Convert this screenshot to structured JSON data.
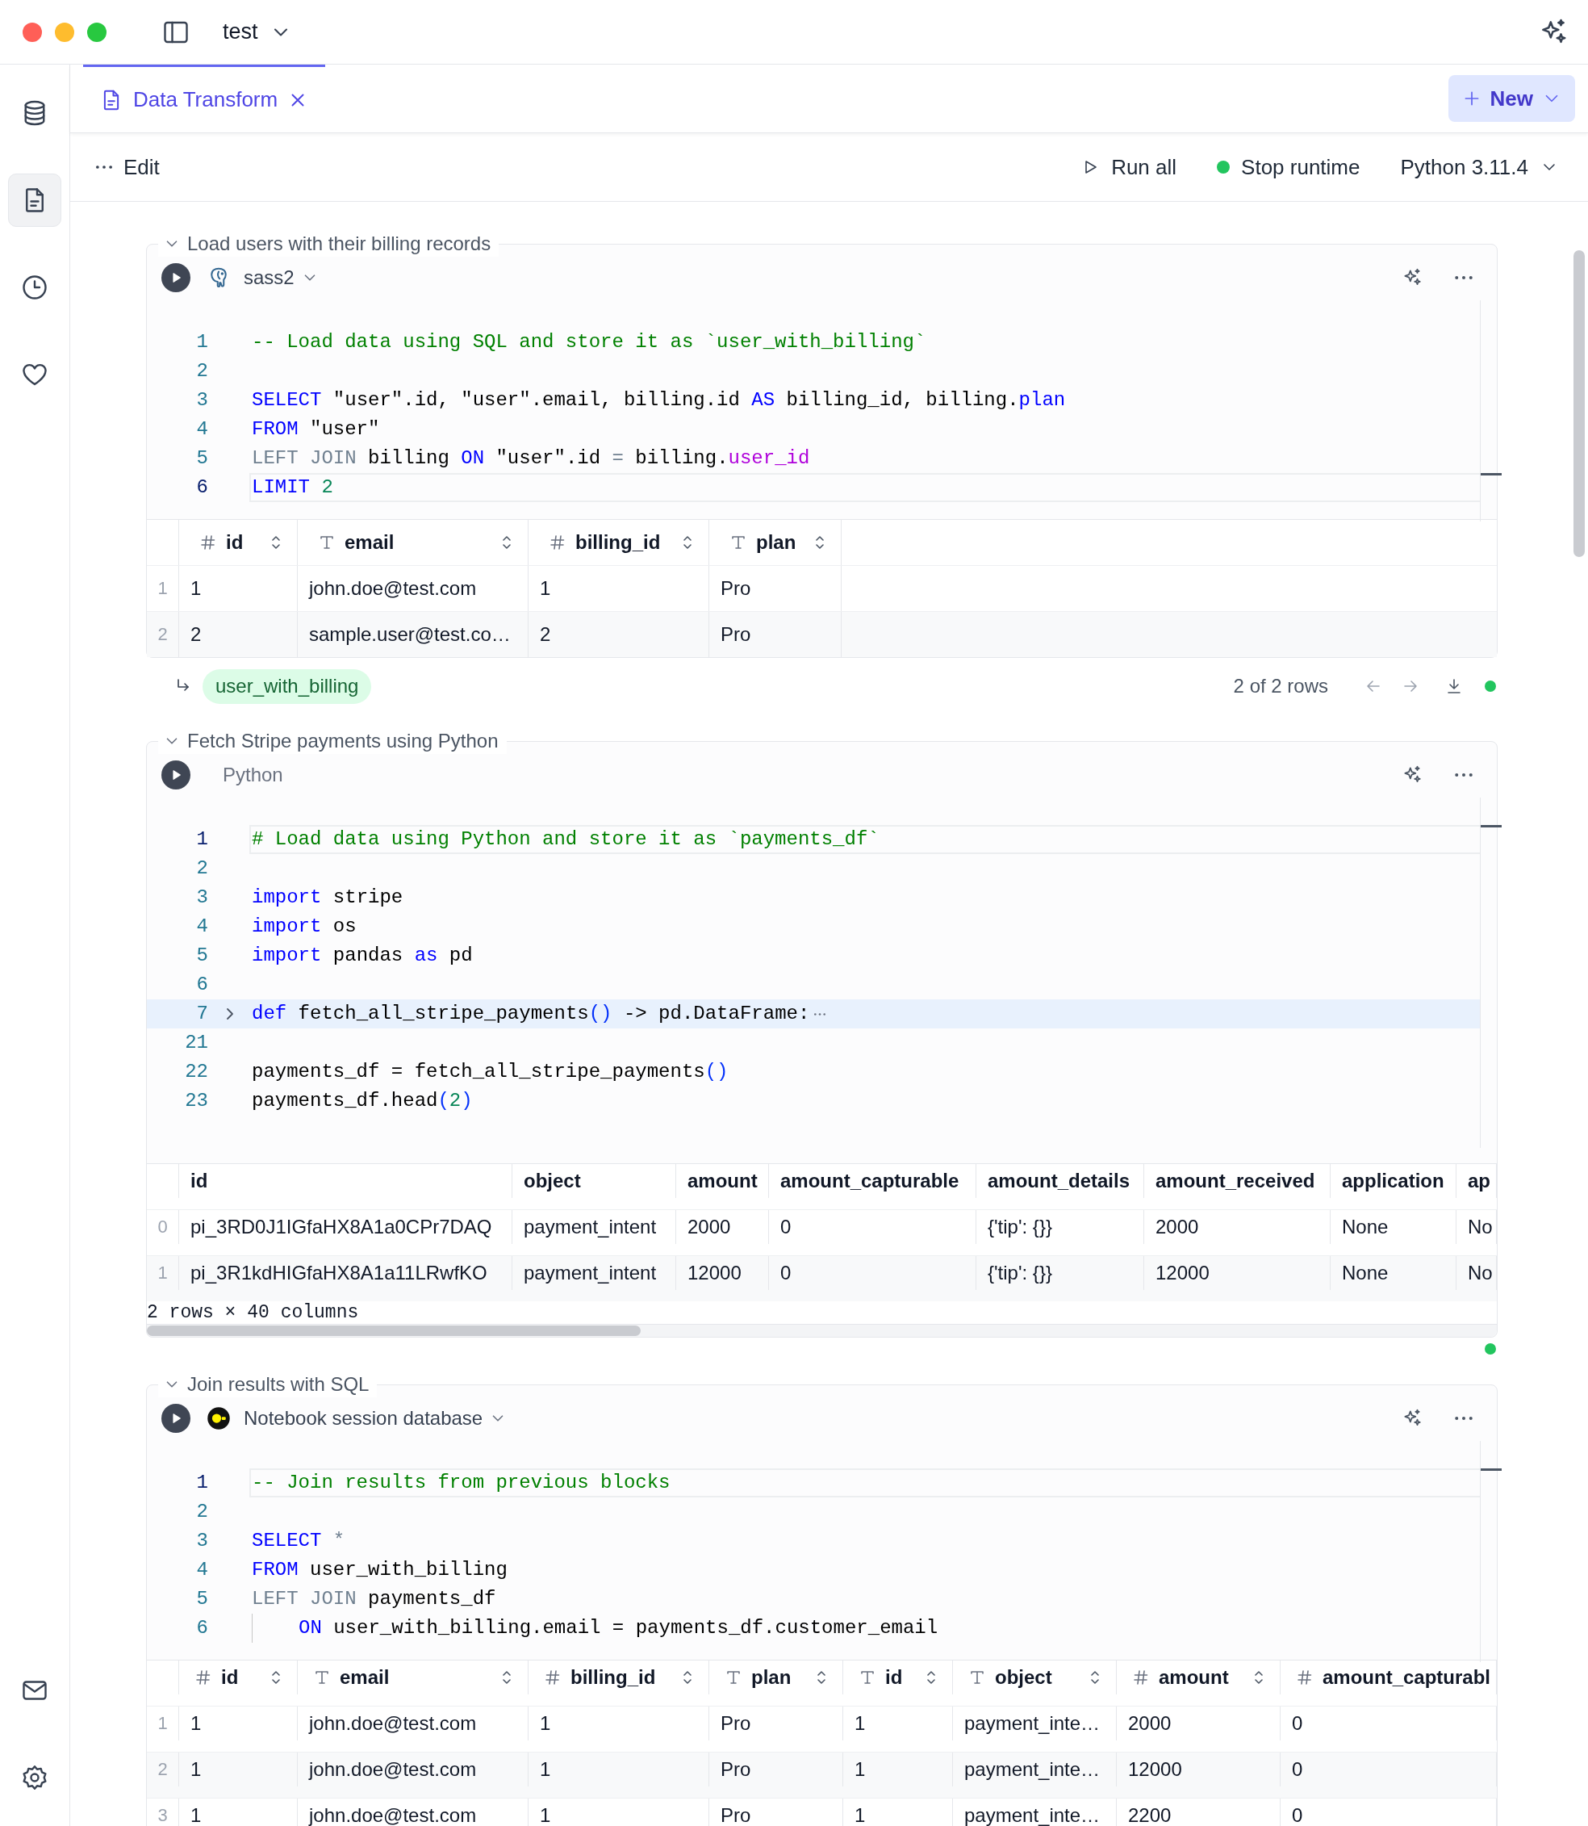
{
  "titlebar": {
    "title": "test"
  },
  "sidebar": {
    "items": [
      {
        "kind": "database",
        "selected": false
      },
      {
        "kind": "notebook",
        "selected": true
      },
      {
        "kind": "history",
        "selected": false
      },
      {
        "kind": "favorites",
        "selected": false
      }
    ],
    "bottom_items": [
      {
        "kind": "mail"
      },
      {
        "kind": "settings"
      }
    ]
  },
  "tabs": [
    {
      "label": "Data Transform",
      "selected": true
    }
  ],
  "new_button": {
    "label": "New"
  },
  "toolbar": {
    "edit": "Edit",
    "run_all": "Run all",
    "stop_runtime": "Stop runtime",
    "runtime_running": true,
    "kernel": "Python 3.11.4"
  },
  "cells": [
    {
      "title": "Load users with their billing records",
      "expanded": true,
      "source": {
        "kind": "postgres",
        "label": "sass2",
        "dropdown": true
      },
      "code": [
        {
          "n": "1",
          "kind": "normal",
          "tokens": [
            {
              "kind": "comment",
              "text": "-- Load data using SQL and store it as `user_with_billing`"
            }
          ]
        },
        {
          "n": "2",
          "kind": "normal"
        },
        {
          "n": "3",
          "kind": "normal",
          "tokens": [
            {
              "kind": "keyword",
              "text": "SELECT"
            },
            {
              "kind": "plain",
              "text": " \"user\".id, \"user\".email, billing.id "
            },
            {
              "kind": "keyword",
              "text": "AS"
            },
            {
              "kind": "plain",
              "text": " billing_id, billing."
            },
            {
              "kind": "keyword",
              "text": "plan"
            }
          ]
        },
        {
          "n": "4",
          "kind": "normal",
          "tokens": [
            {
              "kind": "keyword",
              "text": "FROM"
            },
            {
              "kind": "plain",
              "text": " \"user\""
            }
          ]
        },
        {
          "n": "5",
          "kind": "normal",
          "tokens": [
            {
              "kind": "dim",
              "text": "LEFT JOIN"
            },
            {
              "kind": "plain",
              "text": " billing "
            },
            {
              "kind": "keyword",
              "text": "ON"
            },
            {
              "kind": "plain",
              "text": " \"user\".id "
            },
            {
              "kind": "dim",
              "text": "="
            },
            {
              "kind": "plain",
              "text": " billing."
            },
            {
              "kind": "property",
              "text": "user_id"
            }
          ]
        },
        {
          "n": "6",
          "kind": "active",
          "tokens": [
            {
              "kind": "keyword",
              "text": "LIMIT"
            },
            {
              "kind": "number",
              "text": " 2"
            }
          ]
        }
      ],
      "table": {
        "columns": [
          {
            "label": "id",
            "kind": "number"
          },
          {
            "label": "email",
            "kind": "text"
          },
          {
            "label": "billing_id",
            "kind": "number"
          },
          {
            "label": "plan",
            "kind": "text"
          }
        ],
        "rows": [
          {
            "index": "1",
            "cells": [
              "1",
              "john.doe@test.com",
              "1",
              "Pro"
            ]
          },
          {
            "index": "2",
            "cells": [
              "2",
              "sample.user@test.co…",
              "2",
              "Pro"
            ]
          }
        ]
      },
      "footer": {
        "variable": "user_with_billing",
        "row_count": "2 of 2 rows"
      },
      "succeeded": true
    },
    {
      "title": "Fetch Stripe payments using Python",
      "expanded": true,
      "source": {
        "kind": "python",
        "label": "Python",
        "dropdown": false
      },
      "code": [
        {
          "n": "1",
          "kind": "active",
          "tokens": [
            {
              "kind": "comment",
              "text": "# Load data using Python and store it as `payments_df`"
            }
          ]
        },
        {
          "n": "2",
          "kind": "normal"
        },
        {
          "n": "3",
          "kind": "normal",
          "tokens": [
            {
              "kind": "keyword",
              "text": "import"
            },
            {
              "kind": "plain",
              "text": " stripe"
            }
          ]
        },
        {
          "n": "4",
          "kind": "normal",
          "tokens": [
            {
              "kind": "keyword",
              "text": "import"
            },
            {
              "kind": "plain",
              "text": " os"
            }
          ]
        },
        {
          "n": "5",
          "kind": "normal",
          "tokens": [
            {
              "kind": "keyword",
              "text": "import"
            },
            {
              "kind": "plain",
              "text": " pandas "
            },
            {
              "kind": "keyword",
              "text": "as"
            },
            {
              "kind": "plain",
              "text": " pd"
            }
          ]
        },
        {
          "n": "6",
          "kind": "normal"
        },
        {
          "n": "7",
          "kind": "folded",
          "tokens": [
            {
              "kind": "keyword",
              "text": "def"
            },
            {
              "kind": "plain",
              "text": " fetch_all_stripe_payments"
            },
            {
              "kind": "punct",
              "text": "()"
            },
            {
              "kind": "plain",
              "text": " -> pd.DataFrame:"
            }
          ]
        },
        {
          "n": "21",
          "kind": "normal"
        },
        {
          "n": "22",
          "kind": "normal",
          "tokens": [
            {
              "kind": "plain",
              "text": "payments_df = fetch_all_stripe_payments"
            },
            {
              "kind": "punct",
              "text": "()"
            }
          ]
        },
        {
          "n": "23",
          "kind": "normal",
          "tokens": [
            {
              "kind": "plain",
              "text": "payments_df.head"
            },
            {
              "kind": "punct",
              "text": "("
            },
            {
              "kind": "number",
              "text": "2"
            },
            {
              "kind": "punct",
              "text": ")"
            }
          ]
        }
      ],
      "table": {
        "columns": [
          {
            "label": "id"
          },
          {
            "label": "object"
          },
          {
            "label": "amount"
          },
          {
            "label": "amount_capturable"
          },
          {
            "label": "amount_details"
          },
          {
            "label": "amount_received"
          },
          {
            "label": "application"
          },
          {
            "label": "ap"
          }
        ],
        "rows": [
          {
            "index": "0",
            "cells": [
              "pi_3RD0J1IGfaHX8A1a0CPr7DAQ",
              "payment_intent",
              "2000",
              "0",
              "{'tip': {}}",
              "2000",
              "None",
              "No"
            ]
          },
          {
            "index": "1",
            "cells": [
              "pi_3R1kdHIGfaHX8A1a11LRwfKO",
              "payment_intent",
              "12000",
              "0",
              "{'tip': {}}",
              "12000",
              "None",
              "No"
            ]
          }
        ],
        "summary": "2 rows × 40 columns"
      },
      "succeeded": true
    },
    {
      "title": "Join results with SQL",
      "expanded": true,
      "source": {
        "kind": "session",
        "label": "Notebook session database",
        "dropdown": true
      },
      "code": [
        {
          "n": "1",
          "kind": "active",
          "tokens": [
            {
              "kind": "comment",
              "text": "-- Join results from previous blocks"
            }
          ]
        },
        {
          "n": "2",
          "kind": "normal"
        },
        {
          "n": "3",
          "kind": "normal",
          "tokens": [
            {
              "kind": "keyword",
              "text": "SELECT"
            },
            {
              "kind": "dim",
              "text": " *"
            }
          ]
        },
        {
          "n": "4",
          "kind": "normal",
          "tokens": [
            {
              "kind": "keyword",
              "text": "FROM"
            },
            {
              "kind": "plain",
              "text": " user_with_billing"
            }
          ]
        },
        {
          "n": "5",
          "kind": "normal",
          "tokens": [
            {
              "kind": "dim",
              "text": "LEFT JOIN"
            },
            {
              "kind": "plain",
              "text": " payments_df"
            }
          ]
        },
        {
          "n": "6",
          "kind": "indented",
          "tokens": [
            {
              "kind": "keyword",
              "text": "ON"
            },
            {
              "kind": "plain",
              "text": " user_with_billing.email = payments_df.customer_email"
            }
          ]
        }
      ],
      "table": {
        "columns": [
          {
            "label": "id",
            "kind": "number"
          },
          {
            "label": "email",
            "kind": "text"
          },
          {
            "label": "billing_id",
            "kind": "number"
          },
          {
            "label": "plan",
            "kind": "text"
          },
          {
            "label": "id",
            "kind": "text"
          },
          {
            "label": "object",
            "kind": "text"
          },
          {
            "label": "amount",
            "kind": "number"
          },
          {
            "label": "amount_capturabl",
            "kind": "number"
          }
        ],
        "rows": [
          {
            "index": "1",
            "cells": [
              "1",
              "john.doe@test.com",
              "1",
              "Pro",
              "1",
              "payment_inte…",
              "2000",
              "0"
            ]
          },
          {
            "index": "2",
            "cells": [
              "1",
              "john.doe@test.com",
              "1",
              "Pro",
              "1",
              "payment_inte…",
              "12000",
              "0"
            ]
          },
          {
            "index": "3",
            "cells": [
              "1",
              "john.doe@test.com",
              "1",
              "Pro",
              "1",
              "payment_inte…",
              "2200",
              "0"
            ]
          }
        ]
      }
    }
  ]
}
